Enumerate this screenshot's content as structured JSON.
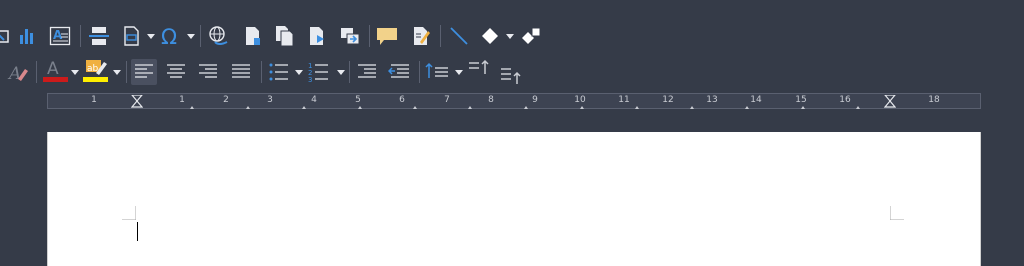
{
  "app": "LibreOffice Writer",
  "toolbar_row1": {
    "tools": [
      "image-icon",
      "chart-icon",
      "text-box-icon",
      "page-break-icon",
      "field-icon",
      "special-character-icon",
      "hyperlink-icon",
      "footnote-icon",
      "endnote-icon",
      "bookmark-icon",
      "cross-reference-icon",
      "comment-icon",
      "track-changes-icon",
      "line-icon",
      "basic-shapes-icon",
      "shapes-extra-icon"
    ]
  },
  "toolbar_row2": {
    "tools": [
      "clear-formatting-icon",
      "font-color-icon",
      "highlight-color-icon",
      "align-left-icon",
      "align-center-icon",
      "align-right-icon",
      "justify-icon",
      "unordered-list-icon",
      "ordered-list-icon",
      "increase-indent-icon",
      "decrease-indent-icon",
      "paragraph-spacing-icon",
      "increase-spacing-icon",
      "decrease-spacing-icon"
    ],
    "font_color": "#cc1b1b",
    "highlight_color": "#ffef00",
    "active_alignment": "align-left"
  },
  "ruler": {
    "labels": [
      "1",
      "1",
      "2",
      "3",
      "4",
      "5",
      "6",
      "7",
      "8",
      "9",
      "10",
      "11",
      "12",
      "13",
      "14",
      "15",
      "16",
      "18"
    ]
  },
  "colors": {
    "toolbar_bg": "#353b48",
    "icon_light": "#e8eaef",
    "accent_blue": "#3d8fe0",
    "page_bg": "#ffffff"
  }
}
